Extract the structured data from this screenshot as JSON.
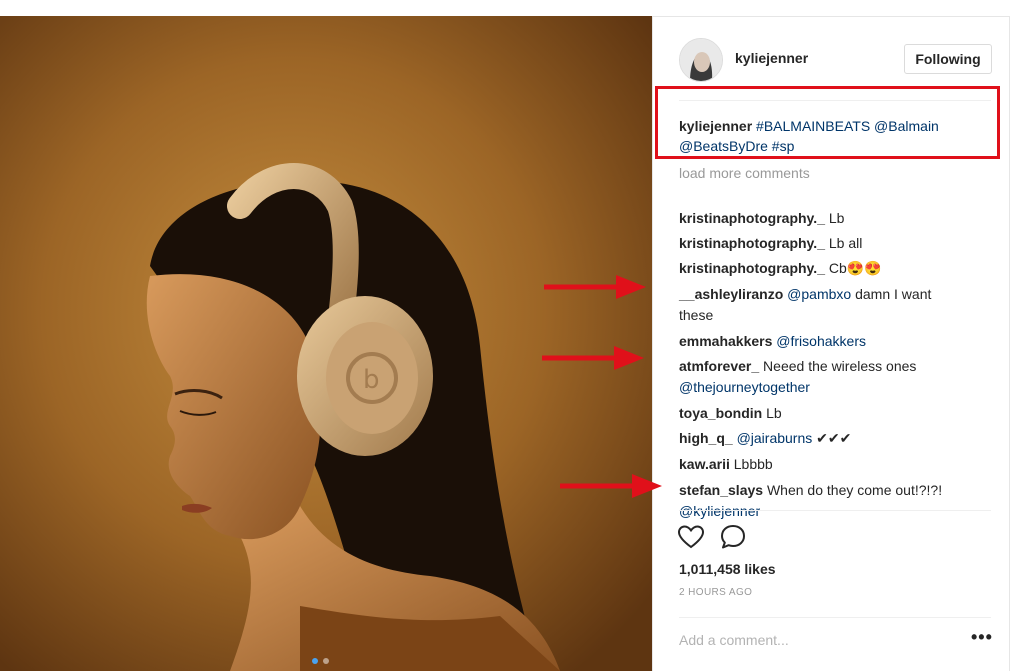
{
  "post": {
    "username": "kyliejenner",
    "follow_label": "Following",
    "caption": {
      "user": "kyliejenner",
      "line1_text": "#BALMAINBEATS @Balmain",
      "line2_text": "@BeatsByDre #sp"
    },
    "load_more": "load more comments",
    "comments": [
      {
        "user": "kristinaphotography._",
        "text": "Lb",
        "cont": ""
      },
      {
        "user": "kristinaphotography._",
        "text": "Lb all",
        "cont": ""
      },
      {
        "user": "kristinaphotography._",
        "text": "Cb😍😍",
        "cont": ""
      },
      {
        "user": "__ashleyliranzo",
        "text": "@pambxo damn I want",
        "cont": "these"
      },
      {
        "user": "emmahakkers",
        "text": "@frisohakkers",
        "cont": ""
      },
      {
        "user": "atmforever_",
        "text": "Neeed the wireless ones",
        "cont": "@thejourneytogether"
      },
      {
        "user": "toya_bondin",
        "text": "Lb",
        "cont": ""
      },
      {
        "user": "high_q_",
        "text": "@jairaburns ✔✔✔",
        "cont": ""
      },
      {
        "user": "kaw.arii",
        "text": "Lbbbb",
        "cont": ""
      },
      {
        "user": "stefan_slays",
        "text": "When do they come out!?!?!",
        "cont": "@kyliejenner"
      }
    ],
    "likes": "1,011,458 likes",
    "time": "2 HOURS AGO",
    "add_comment_placeholder": "Add a comment...",
    "more_label": "•••"
  },
  "colors": {
    "annotation": "#e0101a",
    "link": "#003569",
    "carousel_active": "#4aa3f0"
  },
  "icons": [
    "heart-icon",
    "comment-icon",
    "more-options-icon"
  ]
}
